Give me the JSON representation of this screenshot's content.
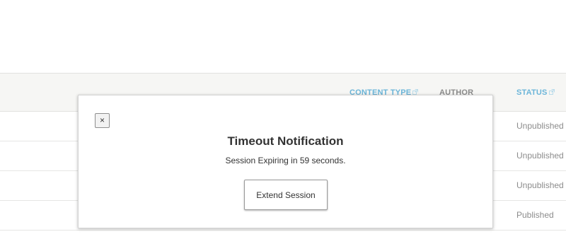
{
  "table": {
    "headers": [
      {
        "label": "CONTENT TYPE",
        "sortable": true
      },
      {
        "label": "AUTHOR",
        "sortable": false
      },
      {
        "label": "STATUS",
        "sortable": true
      }
    ],
    "rows": [
      {
        "status": "Unpublished"
      },
      {
        "status": "Unpublished"
      },
      {
        "status": "Unpublished"
      },
      {
        "status": "Published"
      }
    ]
  },
  "dialog": {
    "close_label": "×",
    "title": "Timeout Notification",
    "message": "Session Expiring in 59 seconds.",
    "extend_button_label": "Extend Session"
  },
  "colors": {
    "link": "#6bb5d9",
    "muted": "#8a8a8a",
    "header_bg": "#f6f6f4"
  }
}
